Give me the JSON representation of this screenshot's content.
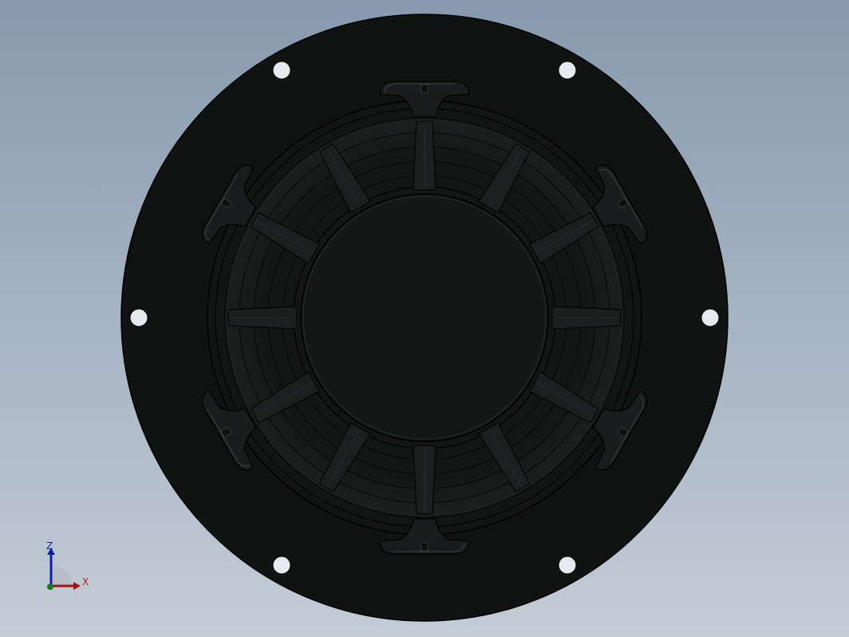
{
  "viewport": {
    "background_top": "#8799ae",
    "background_bottom": "#c4ccd6"
  },
  "model": {
    "name": "speaker-mounting-plate",
    "flange_color": "#111313",
    "edge_color": "#000000",
    "mounting_hole_count": 6,
    "rib_count": 12,
    "clip_count": 6
  },
  "triad": {
    "z_label": "Z",
    "x_label": "X",
    "z_color": "#0b1fb5",
    "x_color": "#a51212",
    "y_color": "#1a7a1a"
  }
}
